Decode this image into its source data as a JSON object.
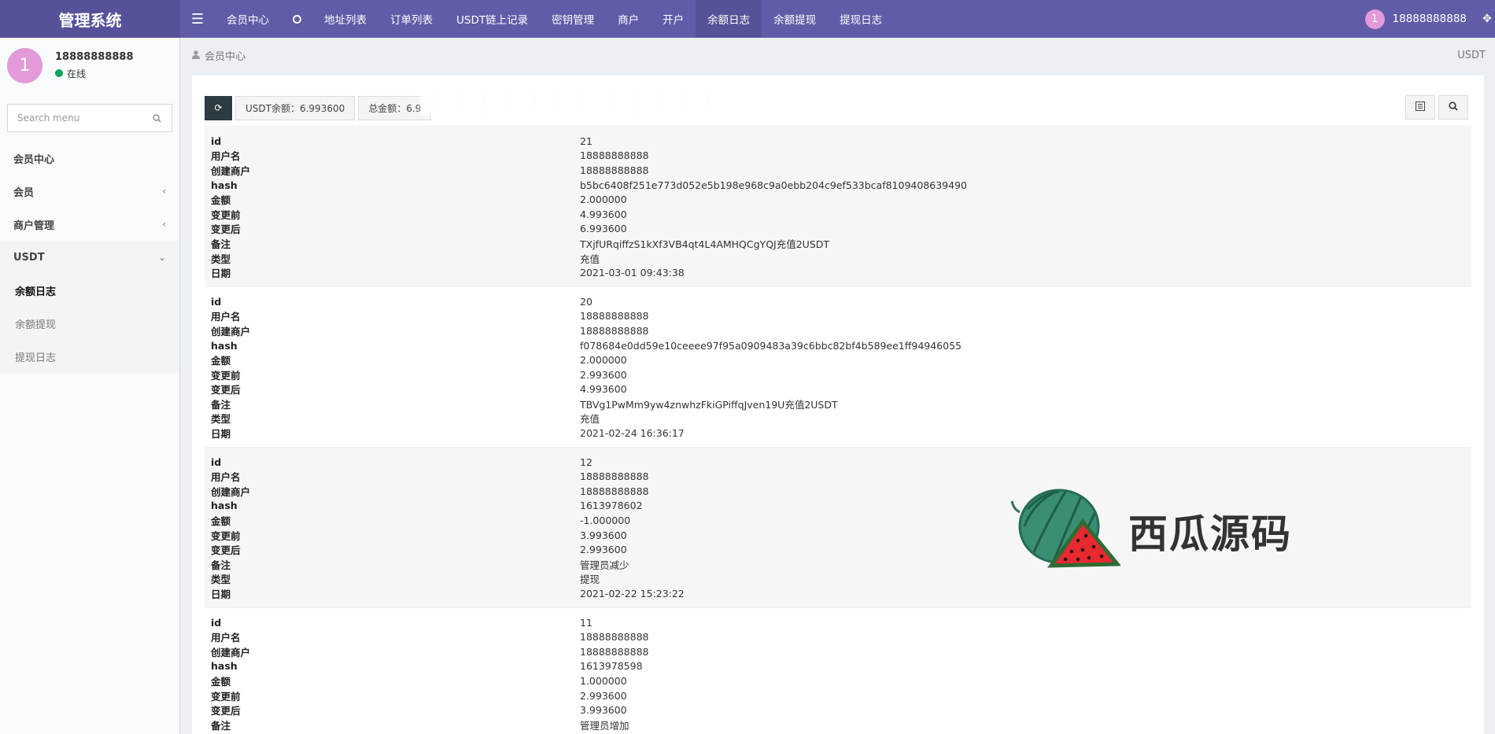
{
  "app": {
    "title": "管理系统"
  },
  "nav": {
    "items": [
      {
        "label": "会员中心"
      },
      {
        "label": "地址列表"
      },
      {
        "label": "订单列表"
      },
      {
        "label": "USDT链上记录"
      },
      {
        "label": "密钥管理"
      },
      {
        "label": "商户"
      },
      {
        "label": "开户"
      },
      {
        "label": "余额日志",
        "active": true
      },
      {
        "label": "余额提现"
      },
      {
        "label": "提现日志"
      }
    ]
  },
  "user": {
    "avatar_initial": "1",
    "name": "18888888888",
    "status": "在线",
    "status_color": "#00a65a"
  },
  "sidebar": {
    "search_placeholder": "Search menu",
    "menu": [
      {
        "label": "会员中心"
      },
      {
        "label": "会员",
        "chevron": "‹"
      },
      {
        "label": "商户管理",
        "chevron": "‹"
      },
      {
        "label": "USDT",
        "chevron": "⌄"
      }
    ],
    "submenu": [
      {
        "label": "余额日志",
        "active": true
      },
      {
        "label": "余额提现"
      },
      {
        "label": "提现日志"
      }
    ]
  },
  "breadcrumb": {
    "current": "会员中心",
    "right": "USDT"
  },
  "toolbar": {
    "usdt_balance": "USDT余额：6.993600",
    "total_balance": "总金额：6.9"
  },
  "field_labels": {
    "id": "id",
    "username": "用户名",
    "merchant": "创建商户",
    "hash": "hash",
    "amount": "金额",
    "before": "变更前",
    "after": "变更后",
    "remark": "备注",
    "type": "类型",
    "date": "日期"
  },
  "records": [
    {
      "id": "21",
      "username": "18888888888",
      "merchant": "18888888888",
      "hash": "b5bc6408f251e773d052e5b198e968c9a0ebb204c9ef533bcaf8109408639490",
      "amount": "2.000000",
      "before": "4.993600",
      "after": "6.993600",
      "remark": "TXjfURqiffzS1kXf3VB4qt4L4AMHQCgYQJ充值2USDT",
      "type": "充值",
      "date": "2021-03-01 09:43:38"
    },
    {
      "id": "20",
      "username": "18888888888",
      "merchant": "18888888888",
      "hash": "f078684e0dd59e10ceeee97f95a0909483a39c6bbc82bf4b589ee1ff94946055",
      "amount": "2.000000",
      "before": "2.993600",
      "after": "4.993600",
      "remark": "TBVg1PwMm9yw4znwhzFkiGPiffqJven19U充值2USDT",
      "type": "充值",
      "date": "2021-02-24 16:36:17"
    },
    {
      "id": "12",
      "username": "18888888888",
      "merchant": "18888888888",
      "hash": "1613978602",
      "amount": "-1.000000",
      "before": "3.993600",
      "after": "2.993600",
      "remark": "管理员减少",
      "type": "提现",
      "date": "2021-02-22 15:23:22"
    },
    {
      "id": "11",
      "username": "18888888888",
      "merchant": "18888888888",
      "hash": "1613978598",
      "amount": "1.000000",
      "before": "2.993600",
      "after": "3.993600",
      "remark": "管理员增加",
      "type": "",
      "date": ""
    }
  ],
  "watermark": {
    "text": "西瓜源码"
  }
}
